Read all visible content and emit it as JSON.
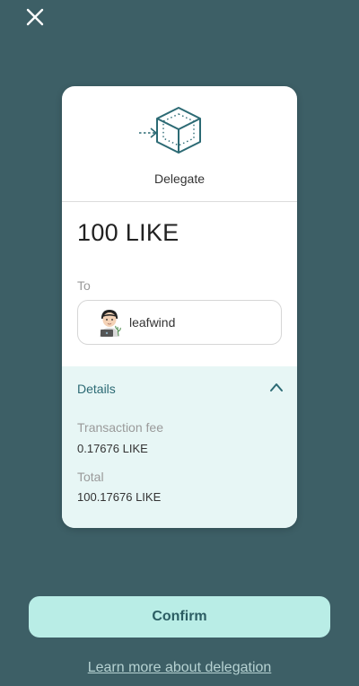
{
  "header": {
    "close_icon": "close-icon"
  },
  "card": {
    "action_icon": "delegate-cube-icon",
    "title": "Delegate",
    "amount": "100 LIKE",
    "to_label": "To",
    "recipient": {
      "avatar": "avatar",
      "name": "leafwind"
    },
    "details": {
      "label": "Details",
      "toggle_icon": "chevron-up-icon",
      "fee_label": "Transaction fee",
      "fee_value": "0.17676 LIKE",
      "total_label": "Total",
      "total_value": "100.17676 LIKE"
    }
  },
  "footer": {
    "confirm_label": "Confirm",
    "learn_more_label": "Learn more about delegation"
  },
  "colors": {
    "background": "#3d5f66",
    "card": "#ffffff",
    "details_bg": "#e7f6f5",
    "accent": "#2c6a74",
    "confirm_bg": "#b9ede6"
  }
}
